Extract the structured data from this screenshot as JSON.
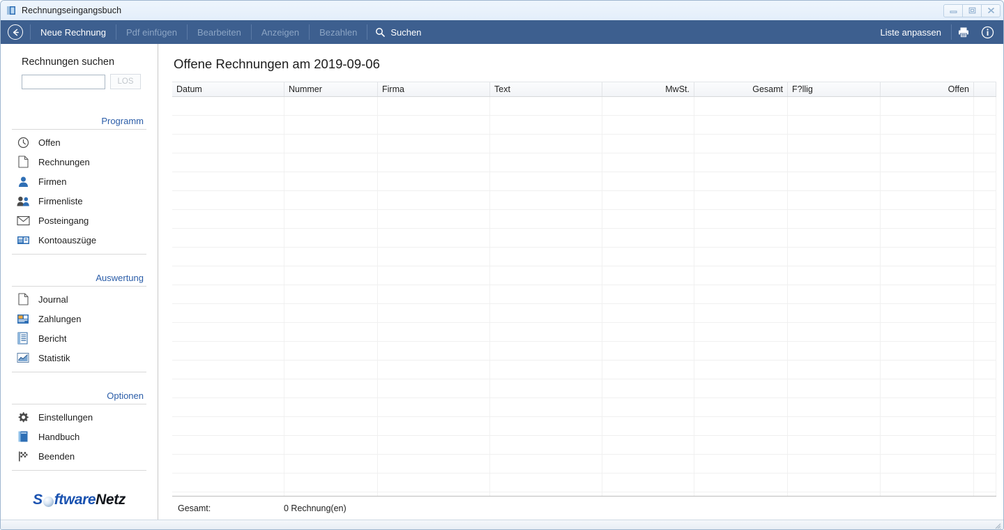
{
  "window": {
    "title": "Rechnungseingangsbuch",
    "icon": "ledger-book-icon",
    "controls": {
      "minimize": "—",
      "restore": "❐",
      "close": "✕"
    }
  },
  "toolbar": {
    "back_icon": "back-arrow-icon",
    "items": [
      {
        "label": "Neue Rechnung",
        "enabled": true
      },
      {
        "label": "Pdf einfügen",
        "enabled": false
      },
      {
        "label": "Bearbeiten",
        "enabled": false
      },
      {
        "label": "Anzeigen",
        "enabled": false
      },
      {
        "label": "Bezahlen",
        "enabled": false
      },
      {
        "label": "Suchen",
        "enabled": true,
        "icon": "magnifier-icon"
      }
    ],
    "right": {
      "customize_label": "Liste anpassen",
      "print_icon": "printer-icon",
      "info_icon": "info-circle-icon"
    },
    "background": "#3d5f8f"
  },
  "sidebar": {
    "search": {
      "title": "Rechnungen suchen",
      "input_value": "",
      "input_placeholder": "",
      "button_label": "LOS",
      "button_enabled": false
    },
    "groups": [
      {
        "title": "Programm",
        "items": [
          {
            "label": "Offen",
            "icon": "clock-icon"
          },
          {
            "label": "Rechnungen",
            "icon": "document-icon"
          },
          {
            "label": "Firmen",
            "icon": "person-icon"
          },
          {
            "label": "Firmenliste",
            "icon": "people-icon"
          },
          {
            "label": "Posteingang",
            "icon": "envelope-icon"
          },
          {
            "label": "Kontoauszüge",
            "icon": "bank-statement-icon"
          }
        ]
      },
      {
        "title": "Auswertung",
        "items": [
          {
            "label": "Journal",
            "icon": "document-icon"
          },
          {
            "label": "Zahlungen",
            "icon": "payments-icon"
          },
          {
            "label": "Bericht",
            "icon": "report-icon"
          },
          {
            "label": "Statistik",
            "icon": "chart-icon"
          }
        ]
      },
      {
        "title": "Optionen",
        "items": [
          {
            "label": "Einstellungen",
            "icon": "gear-icon"
          },
          {
            "label": "Handbuch",
            "icon": "book-icon"
          },
          {
            "label": "Beenden",
            "icon": "checkered-flag-icon"
          }
        ]
      }
    ],
    "logo": {
      "part1": "S",
      "ball": "o",
      "part2": "ftware",
      "part3": "Netz",
      "blue": "#1a52b0",
      "dark": "#12161c"
    }
  },
  "main": {
    "title": "Offene Rechnungen am 2019-09-06",
    "table": {
      "columns": [
        {
          "label": "Datum",
          "align": "left",
          "width": 161
        },
        {
          "label": "Nummer",
          "align": "left",
          "width": 134
        },
        {
          "label": "Firma",
          "align": "left",
          "width": 161
        },
        {
          "label": "Text",
          "align": "left",
          "width": 161
        },
        {
          "label": "MwSt.",
          "align": "right",
          "width": 132
        },
        {
          "label": "Gesamt",
          "align": "right",
          "width": 134
        },
        {
          "label": "F?llig",
          "align": "left",
          "width": 133
        },
        {
          "label": "Offen",
          "align": "right",
          "width": 134
        },
        {
          "label": "",
          "align": "left",
          "width": 30
        }
      ],
      "rows": [],
      "empty_row_count": 21
    },
    "footer": {
      "label": "Gesamt:",
      "value": "0 Rechnung(en)"
    }
  }
}
